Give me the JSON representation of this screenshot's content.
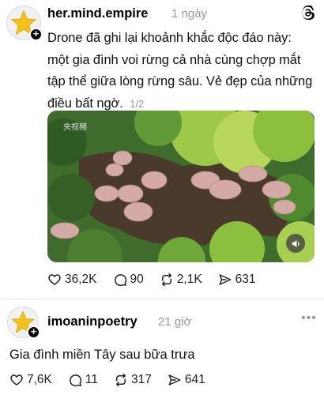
{
  "post": {
    "username": "her.mind.empire",
    "time": "1 ngày",
    "text": "Drone đã ghi lại khoảnh khắc độc đáo này: một gia đình voi rừng cả nhà cùng chợp mắt tập thể giữa lòng rừng sâu. Vẻ đẹp của những điều bất ngờ.",
    "page_count": "1/2",
    "media_watermark": "央视频",
    "likes": "36,2K",
    "comments": "90",
    "reposts": "2,1K",
    "shares": "631"
  },
  "reply": {
    "username": "imoaninpoetry",
    "time": "21 giờ",
    "text": "Gia đình miền Tây sau bữa trưa",
    "likes": "7,6K",
    "comments": "11",
    "reposts": "317",
    "shares": "641"
  },
  "icons": {
    "threads": "threads-logo-icon",
    "like": "heart-icon",
    "comment": "comment-bubble-icon",
    "repost": "repost-icon",
    "share": "send-icon",
    "sound": "speaker-icon",
    "more": "more-dots-icon"
  },
  "colors": {
    "text": "#111111",
    "muted": "#999999",
    "avatar_star": "#f3c21b"
  }
}
